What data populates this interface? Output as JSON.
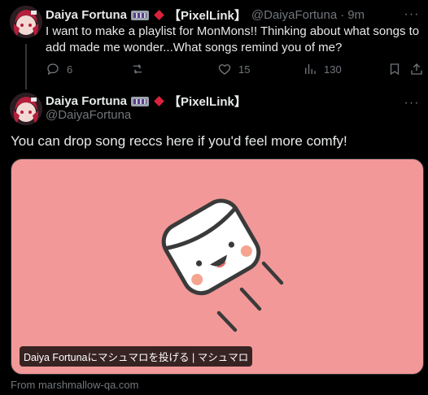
{
  "tweet1": {
    "display_name": "Daiya Fortuna",
    "affiliation": "【PixelLink】",
    "handle": "@DaiyaFortuna",
    "separator": "·",
    "time": "9m",
    "text": "I want to make a playlist for MonMons!! Thinking about what songs to add made me wonder...What songs remind you of me?",
    "actions": {
      "replies": "6",
      "retweets": "",
      "likes": "15",
      "views": "130"
    },
    "more_label": "···"
  },
  "tweet2": {
    "display_name": "Daiya Fortuna",
    "affiliation": "【PixelLink】",
    "handle": "@DaiyaFortuna",
    "text": "You can drop song reccs here if you'd feel more comfy!",
    "more_label": "···",
    "card": {
      "title": "Daiya Fortunaにマシュマロを投げる | マシュマロ",
      "source": "From marshmallow-qa.com"
    }
  },
  "colors": {
    "background": "#000000",
    "text": "#e7e9ea",
    "muted": "#71767b",
    "card_bg": "#f29898",
    "diamond": "#d9223b"
  },
  "icons": [
    "reply-icon",
    "retweet-icon",
    "like-icon",
    "views-icon",
    "bookmark-icon",
    "share-icon",
    "more-icon",
    "marshmallow-illustration"
  ]
}
